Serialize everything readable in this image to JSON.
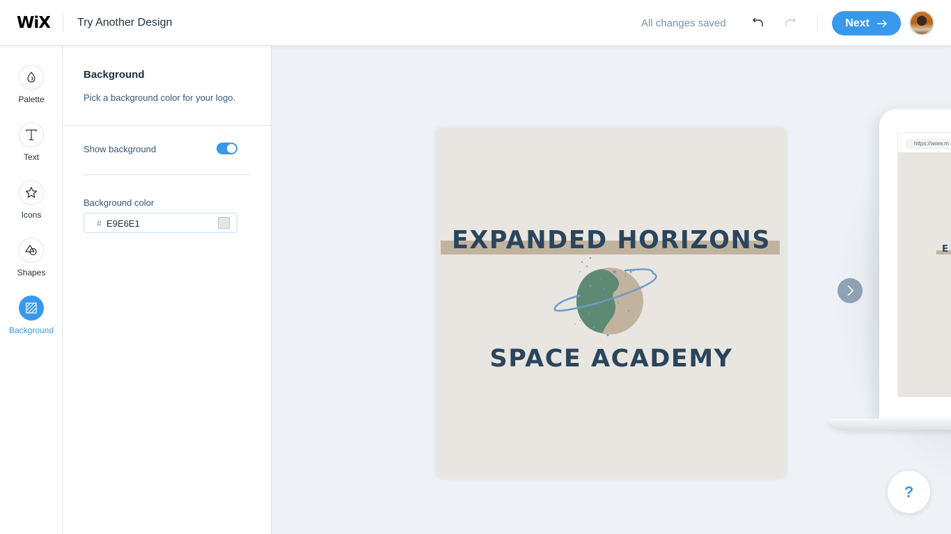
{
  "header": {
    "brand": "WiX",
    "title": "Try Another Design",
    "status": "All changes saved",
    "undo_icon": "undo-icon",
    "redo_icon": "redo-icon",
    "next_label": "Next",
    "next_icon": "arrow-right-icon",
    "avatar": "user-avatar"
  },
  "rail": {
    "items": [
      {
        "label": "Palette",
        "icon": "paint-drop-icon",
        "active": false
      },
      {
        "label": "Text",
        "icon": "text-icon",
        "active": false
      },
      {
        "label": "Icons",
        "icon": "star-icon",
        "active": false
      },
      {
        "label": "Shapes",
        "icon": "shapes-icon",
        "active": false
      },
      {
        "label": "Background",
        "icon": "background-hatch-icon",
        "active": true
      }
    ]
  },
  "panel": {
    "title": "Background",
    "description": "Pick a background color for your logo.",
    "show_background_label": "Show background",
    "show_background": true,
    "background_color_label": "Background color",
    "hash_symbol": "#",
    "background_color_value": "E9E6E1"
  },
  "logo": {
    "line1": "EXPANDED HORIZONS",
    "line2": "SPACE ACADEMY",
    "icon": "planet-with-ring-icon"
  },
  "preview": {
    "url_text": "https://www.m",
    "mini_text": "E"
  },
  "help_label": "?",
  "colors": {
    "accent": "#3899ec",
    "logo_background": "#E9E6E1",
    "logo_text": "#2a455c",
    "logo_bar": "#c2b39f",
    "planet_green": "#5e8a73",
    "planet_tan": "#c2b39f",
    "ring_blue": "#6b9bc9",
    "canvas_background": "#eef1f5"
  }
}
